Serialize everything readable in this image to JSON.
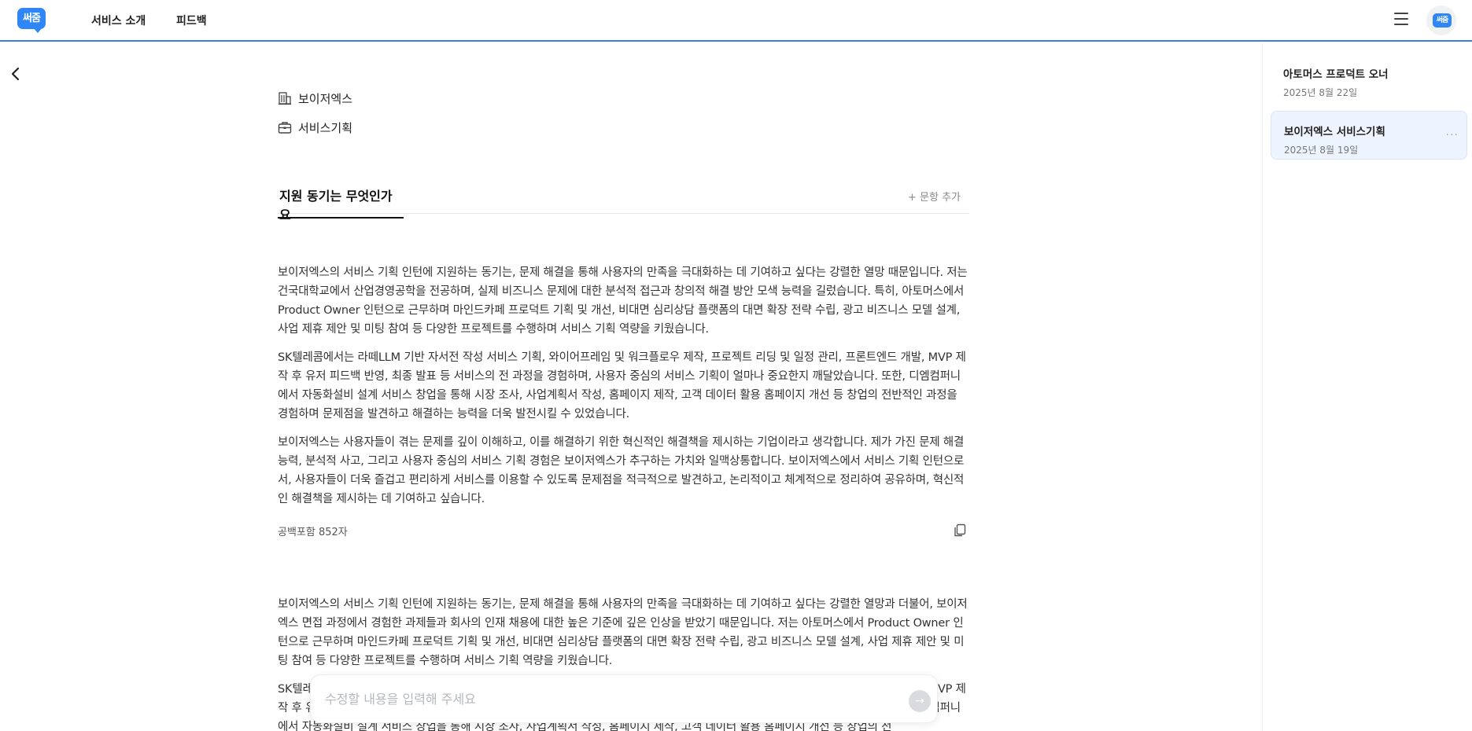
{
  "header": {
    "logo_text": "써줌",
    "nav": [
      {
        "label": "서비스 소개"
      },
      {
        "label": "피드백"
      }
    ],
    "avatar_text": "써줌",
    "accent_color": "#3b7ddd"
  },
  "meta": {
    "company": "보이저엑스",
    "position": "서비스기획"
  },
  "tabs": {
    "active_label": "지원 동기는 무엇인가요",
    "add_label": "+ 문항 추가"
  },
  "answer1": {
    "paragraphs": [
      "보이저엑스의 서비스 기획 인턴에 지원하는 동기는, 문제 해결을 통해 사용자의 만족을 극대화하는 데 기여하고 싶다는 강렬한 열망 때문입니다. 저는 건국대학교에서 산업경영공학을 전공하며, 실제 비즈니스 문제에 대한 분석적 접근과 창의적 해결 방안 모색 능력을 길렀습니다. 특히, 아토머스에서 Product Owner 인턴으로 근무하며 마인드카페 프로덕트 기획 및 개선, 비대면 심리상담 플랫폼의 대면 확장 전략 수립, 광고 비즈니스 모델 설계, 사업 제휴 제안 및 미팅 참여 등 다양한 프로젝트를 수행하며 서비스 기획 역량을 키웠습니다.",
      "SK텔레콤에서는 라떼LLM 기반 자서전 작성 서비스 기획, 와이어프레임 및 워크플로우 제작, 프로젝트 리딩 및 일정 관리, 프론트엔드 개발, MVP 제작 후 유저 피드백 반영, 최종 발표 등 서비스의 전 과정을 경험하며, 사용자 중심의 서비스 기획이 얼마나 중요한지 깨달았습니다. 또한, 디엠컴퍼니에서 자동화설비 설계 서비스 창업을 통해 시장 조사, 사업계획서 작성, 홈페이지 제작, 고객 데이터 활용 홈페이지 개선 등 창업의 전반적인 과정을 경험하며 문제점을 발견하고 해결하는 능력을 더욱 발전시킬 수 있었습니다.",
      "보이저엑스는 사용자들이 겪는 문제를 깊이 이해하고, 이를 해결하기 위한 혁신적인 해결책을 제시하는 기업이라고 생각합니다. 제가 가진 문제 해결 능력, 분석적 사고, 그리고 사용자 중심의 서비스 기획 경험은 보이저엑스가 추구하는 가치와 일맥상통합니다. 보이저엑스에서 서비스 기획 인턴으로서, 사용자들이 더욱 즐겁고 편리하게 서비스를 이용할 수 있도록 문제점을 적극적으로 발견하고, 논리적이고 체계적으로 정리하여 공유하며, 혁신적인 해결책을 제시하는 데 기여하고 싶습니다."
    ],
    "char_count": "공백포함 852자"
  },
  "answer2": {
    "paragraphs": [
      "보이저엑스의 서비스 기획 인턴에 지원하는 동기는, 문제 해결을 통해 사용자의 만족을 극대화하는 데 기여하고 싶다는 강렬한 열망과 더불어, 보이저엑스 면접 과정에서 경험한 과제들과 회사의 인재 채용에 대한 높은 기준에 깊은 인상을 받았기 때문입니다. 저는 아토머스에서 Product Owner 인턴으로 근무하며 마인드카페 프로덕트 기획 및 개선, 비대면 심리상담 플랫폼의 대면 확장 전략 수립, 광고 비즈니스 모델 설계, 사업 제휴 제안 및 미팅 참여 등 다양한 프로젝트를 수행하며 서비스 기획 역량을 키웠습니다.",
      "SK텔레콤에서는 라떼LLM 기반 자서전 작성 서비스 기획, 와이어프레임 및 워크플로우 제작, 프로젝트 리딩 및 일정 관리, 프론트엔드 개발, MVP 제작 후 유저 피드백 반영, 최종 발표 등 서비스의 전 과정을 경험하며, 사용자 중심의 서비스 기획이 얼마나 중요한지 깨달았습니다. 또한, 디엠컴퍼니에서 자동화설비 설계 서비스 창업을 통해 시장 조사, 사업계획서 작성, 홈페이지 제작, 고객 데이터 활용 홈페이지 개선 등 창업의 전"
    ]
  },
  "prompt": {
    "placeholder": "수정할 내용을 입력해 주세요",
    "send_glyph": "→"
  },
  "sidebar": {
    "items": [
      {
        "title": "아토머스 프로덕트 오너",
        "date": "2025년 8월 22일"
      },
      {
        "title": "보이저엑스 서비스기획",
        "date": "2025년 8월 19일",
        "more": "···"
      }
    ]
  }
}
